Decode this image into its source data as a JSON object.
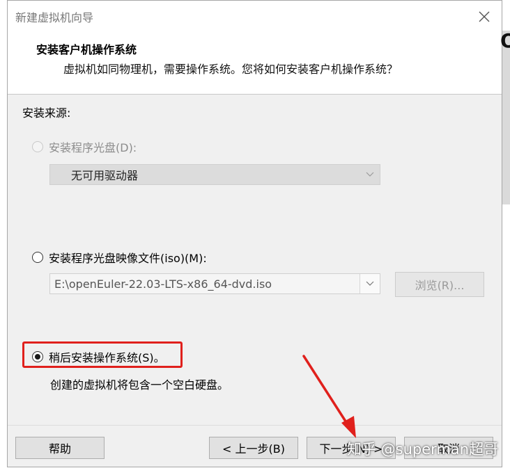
{
  "window": {
    "title": "新建虚拟机向导",
    "header_title": "安装客户机操作系统",
    "header_subtitle": "虚拟机如同物理机，需要操作系统。您将如何安装客户机操作系统？"
  },
  "install_source": {
    "label": "安装来源:",
    "disc_option": {
      "label": "安装程序光盘(D):",
      "selected": false,
      "enabled": false
    },
    "disc_drive_value": "无可用驱动器",
    "iso_option": {
      "label": "安装程序光盘映像文件(iso)(M):",
      "selected": false,
      "enabled": true
    },
    "iso_path_value": "E:\\openEuler-22.03-LTS-x86_64-dvd.iso",
    "browse_label": "浏览(R)...",
    "later_option": {
      "label": "稍后安装操作系统(S)。",
      "selected": true,
      "enabled": true
    },
    "later_hint": "创建的虚拟机将包含一个空白硬盘。"
  },
  "buttons": {
    "help": "帮助",
    "back": "< 上一步(B)",
    "next": "下一步(N) >",
    "cancel": "取消"
  },
  "edge_glyph": "O",
  "watermark": "知乎 @superman超哥",
  "colors": {
    "highlight": "#e0201c",
    "arrow": "#e0201c"
  },
  "icons": {
    "close": "close-icon",
    "dropdown": "chevron-down-icon",
    "annotation": "red-arrow-icon"
  }
}
